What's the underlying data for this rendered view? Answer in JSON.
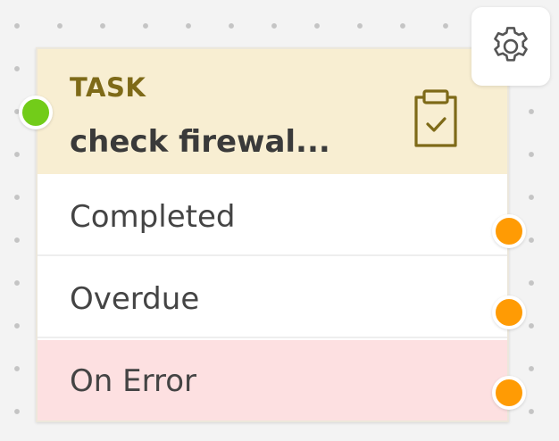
{
  "node": {
    "type_label": "TASK",
    "name": "check firewal...",
    "icon": "clipboard-check-icon",
    "header_color": "#f8eed2",
    "outputs": [
      {
        "label": "Completed",
        "port_color": "#ff9b04"
      },
      {
        "label": "Overdue",
        "port_color": "#ff9b04"
      },
      {
        "label": "On Error",
        "port_color": "#ff9b04",
        "row_color": "#fde0e1"
      }
    ],
    "input_port_color": "#72cc19"
  },
  "toolbar": {
    "settings_icon": "gear-icon"
  },
  "colors": {
    "canvas_background": "#f3f3f3",
    "type_label": "#7e6a18",
    "text": "#444444"
  }
}
